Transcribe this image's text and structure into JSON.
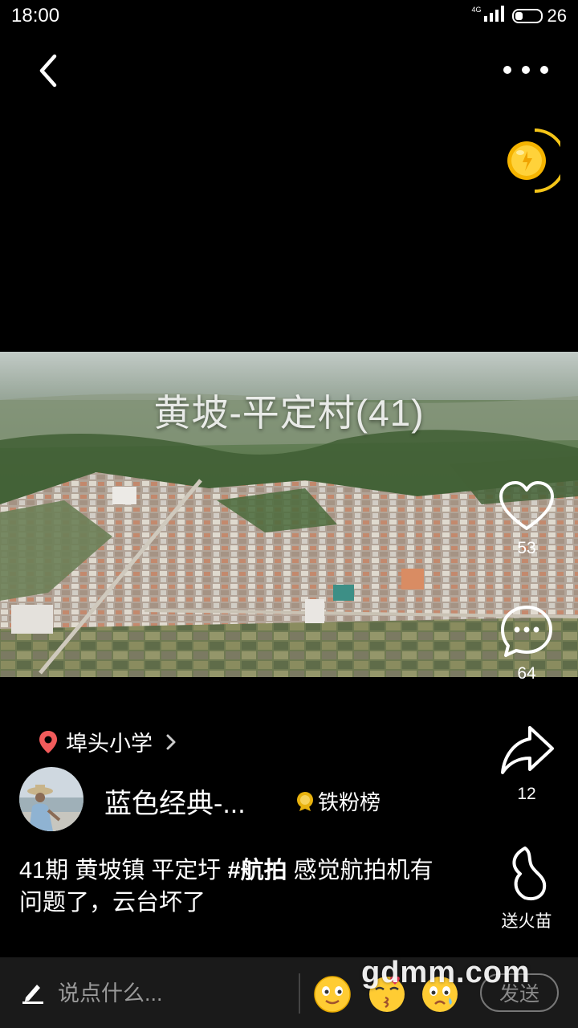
{
  "status_bar": {
    "time": "18:00",
    "network": "4G",
    "battery": "26"
  },
  "header": {
    "back_icon": "chevron-left-icon",
    "more_icon": "ellipsis-icon"
  },
  "coin_widget": {
    "icon": "gold-coin-icon",
    "accent_color": "#f5c518"
  },
  "video": {
    "overlay_title": "黄坡-平定村(41)"
  },
  "actions": {
    "like_count": "53",
    "comment_count": "64",
    "share_count": "12",
    "fire_label": "送火苗"
  },
  "location": {
    "icon": "location-pin-icon",
    "name": "埠头小学",
    "pin_color": "#f25b5b"
  },
  "author": {
    "name": "蓝色经典-...",
    "fans_rank_label": "铁粉榜"
  },
  "caption": {
    "prefix": "41期 黄坡镇  平定圩 ",
    "hashtag": "#航拍",
    "suffix": " 感觉航拍机有问题了，云台坏了"
  },
  "bottom_bar": {
    "input_placeholder": "说点什么...",
    "send_label": "发送"
  },
  "watermark": "gdmm.com"
}
